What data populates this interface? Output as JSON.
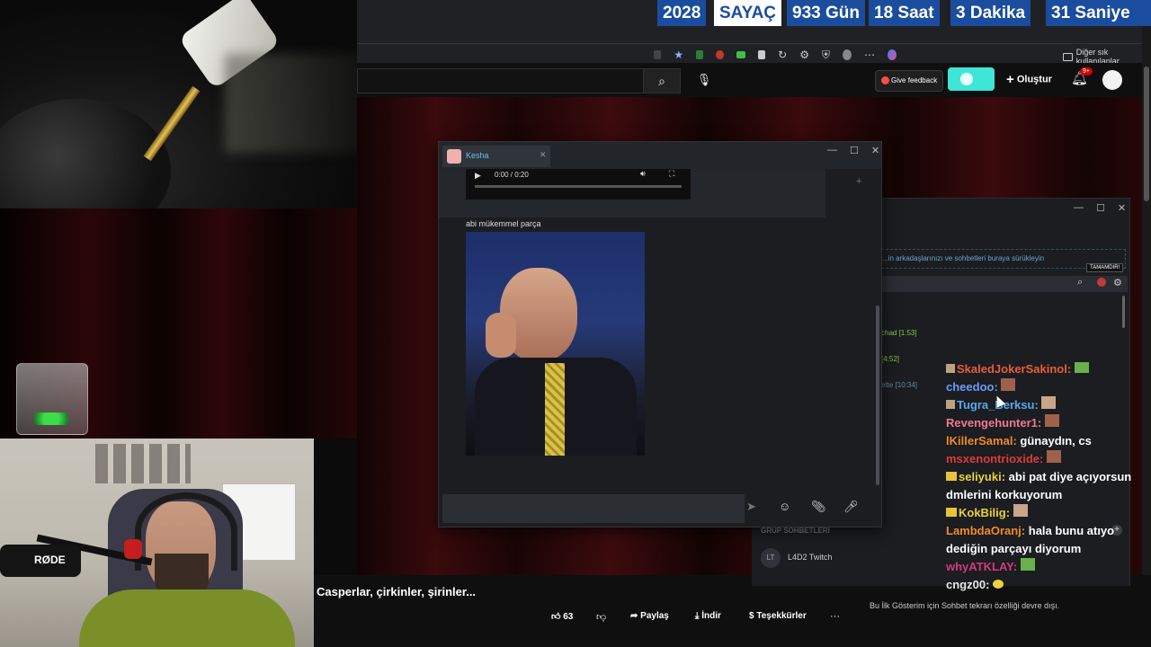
{
  "counter": {
    "year": "2028",
    "label": "SAYAÇ",
    "days": "933 Gün",
    "hours": "18 Saat",
    "minutes": "3  Dakika",
    "seconds": "31 Saniye"
  },
  "browser": {
    "bookmarks_other": "Diğer sık kullanılanlar"
  },
  "youtube": {
    "feedback_label": "Give feedback",
    "create_label": "Oluştur",
    "notif_count": "9+",
    "video_title": "Casperlar, çirkinler, şirinler...",
    "like_count": "63",
    "share_label": "Paylaş",
    "download_label": "İndir",
    "thanks_label": "Teşekkürler",
    "more_label": "···",
    "premiere_note": "Bu İlk Gösterim için Sohbet tekrarı özelliği devre dışı."
  },
  "kesha_window": {
    "contact_name": "Kesha",
    "audio_time": "0:00 / 0:20",
    "message_text": "abi mükemmel parça"
  },
  "friends_window": {
    "drag_hint": "...in arkadaşlarınızı ve sohbetleri buraya sürükleyin",
    "done_badge": "TAMAMDIR!",
    "times": [
      {
        "text": "chad [1:53]"
      },
      {
        "text": "[4:52]"
      },
      {
        "text": "ette [10:34]"
      }
    ],
    "group_header": "GRUP SOHBETLERİ",
    "group_initials": "LT",
    "group_name": "L4D2 Twitch"
  },
  "twitch_chat": [
    {
      "user": "SkaledJokerSakinol",
      "color": "#e85d3a",
      "text": ""
    },
    {
      "user": "cheedoo",
      "color": "#6f9bf5",
      "text": ""
    },
    {
      "user": "Tugra_Berksu",
      "color": "#5aa7e8",
      "text": ""
    },
    {
      "user": "Revengehunter1",
      "color": "#f07a8a",
      "text": ""
    },
    {
      "user": "lKillerSamal",
      "color": "#f08a2a",
      "text": "günaydın, cs"
    },
    {
      "user": "msxenontrioxide",
      "color": "#e03a3a",
      "text": ""
    },
    {
      "user": "seliyuki",
      "color": "#e8d23a",
      "text": "abi pat diye açıyorsun dmlerini korkuyorum"
    },
    {
      "user": "KokBilig",
      "color": "#e8d23a",
      "text": ""
    },
    {
      "user": "LambdaOranj",
      "color": "#f08a2a",
      "text": "hala bunu atıyo dediğin parçayı diyorum"
    },
    {
      "user": "whyATKLAY",
      "color": "#d33a7a",
      "text": ""
    },
    {
      "user": "cngz00",
      "color": "#e8e8e8",
      "text": ""
    }
  ],
  "colors": {
    "counter_blue": "#1a4d9e",
    "yt_red": "#ff0000",
    "accent_cyan": "#3de6d6"
  },
  "overlay": {
    "mic_brand": "RØDE"
  }
}
